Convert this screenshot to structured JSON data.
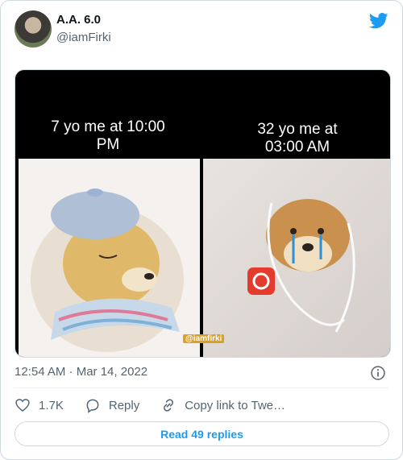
{
  "author": {
    "name": "A.A. 6.0",
    "handle": "@iamFirki"
  },
  "media": {
    "caption_left": "7 yo me at 10:00 PM",
    "caption_right": "32 yo me at 03:00 AM",
    "watermark": "@iamfirki"
  },
  "meta": {
    "timestamp": "12:54 AM · Mar 14, 2022"
  },
  "actions": {
    "likes": "1.7K",
    "reply_label": "Reply",
    "copy_label": "Copy link to Twe…"
  },
  "read_replies": "Read 49 replies",
  "icons": {
    "twitter": "twitter-bird-icon",
    "info": "info-icon",
    "like": "heart-icon",
    "reply": "reply-icon",
    "copy": "link-icon"
  },
  "colors": {
    "accent": "#1d9bf0",
    "secondary_text": "#536471"
  }
}
